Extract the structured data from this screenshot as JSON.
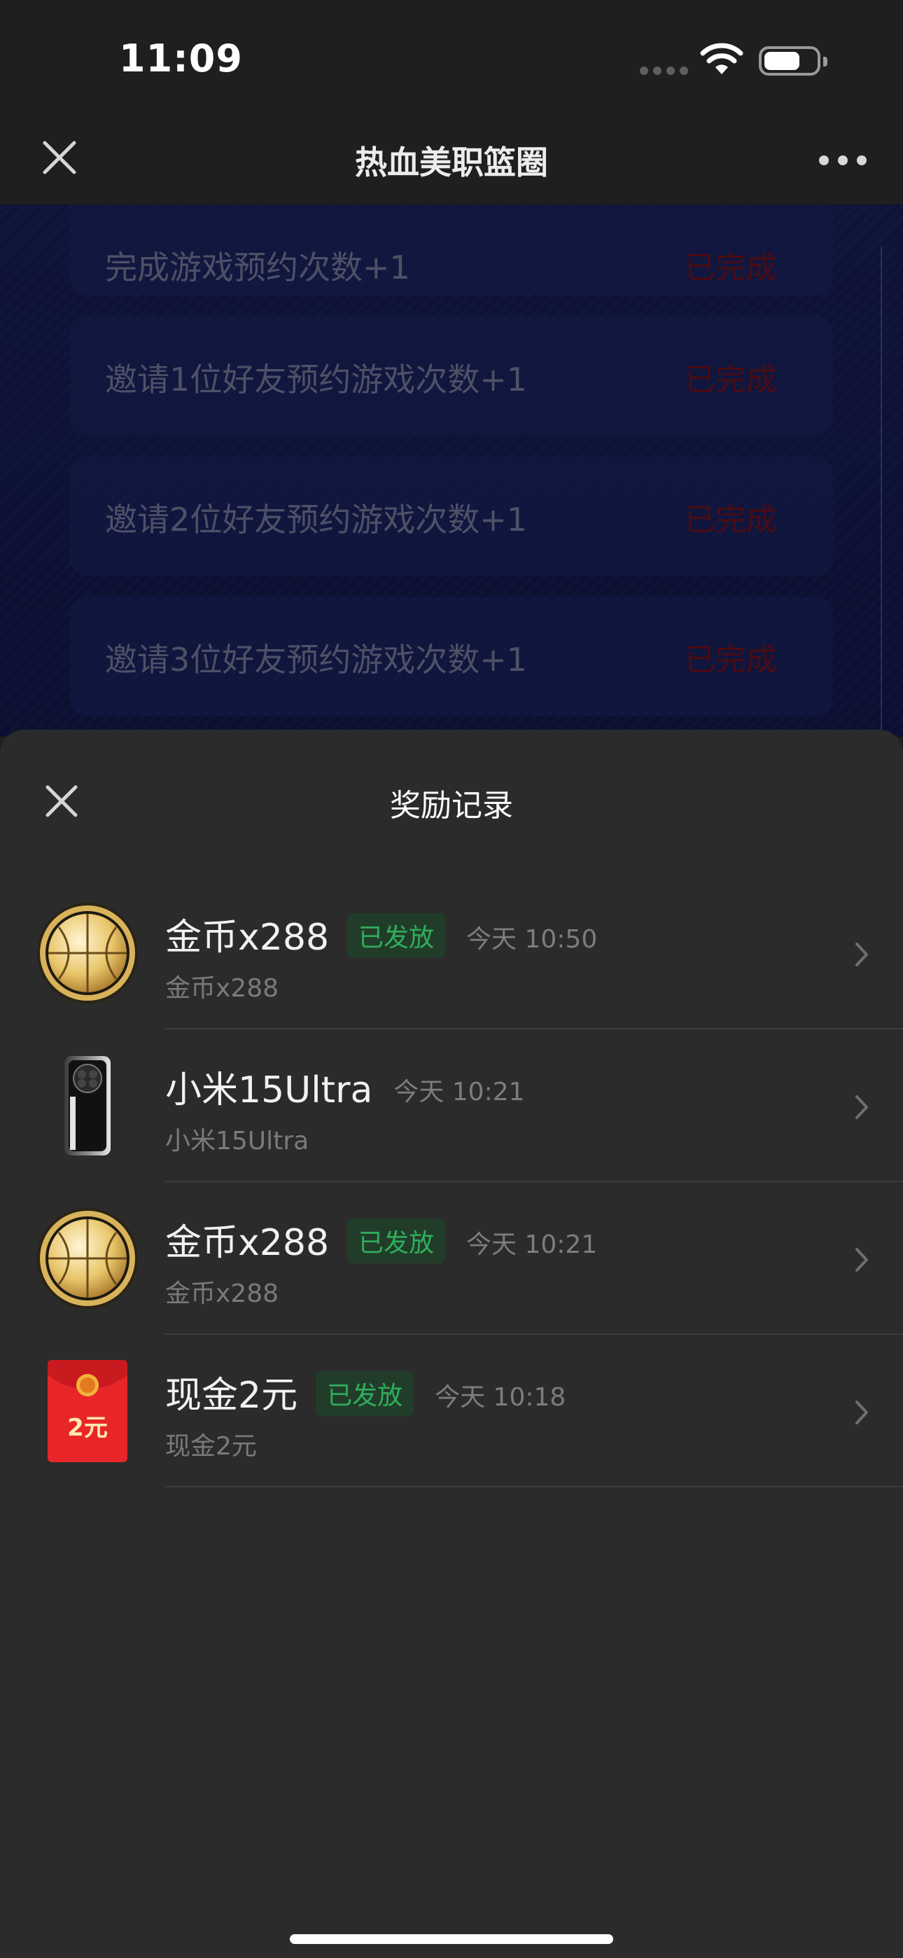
{
  "status_bar": {
    "time": "11:09"
  },
  "nav": {
    "title": "热血美职篮圈"
  },
  "background_tasks": [
    {
      "name": "完成游戏预约次数+1",
      "status": "已完成"
    },
    {
      "name": "邀请1位好友预约游戏次数+1",
      "status": "已完成"
    },
    {
      "name": "邀请2位好友预约游戏次数+1",
      "status": "已完成"
    },
    {
      "name": "邀请3位好友预约游戏次数+1",
      "status": "已完成"
    }
  ],
  "sheet": {
    "title": "奖励记录",
    "items": [
      {
        "icon": "gold-coin-icon",
        "title": "金币x288",
        "badge": "已发放",
        "time": "今天 10:50",
        "subtitle": "金币x288"
      },
      {
        "icon": "phone-icon",
        "title": "小米15Ultra",
        "badge": "",
        "time": "今天 10:21",
        "subtitle": "小米15Ultra"
      },
      {
        "icon": "gold-coin-icon",
        "title": "金币x288",
        "badge": "已发放",
        "time": "今天 10:21",
        "subtitle": "金币x288"
      },
      {
        "icon": "red-envelope-icon",
        "title": "现金2元",
        "badge": "已发放",
        "time": "今天 10:18",
        "subtitle": "现金2元",
        "envelope_text": "2元"
      }
    ]
  },
  "colors": {
    "badge_green": "#2fae5b",
    "sheet_bg": "#2b2b2b",
    "envelope_red": "#e8262a"
  }
}
